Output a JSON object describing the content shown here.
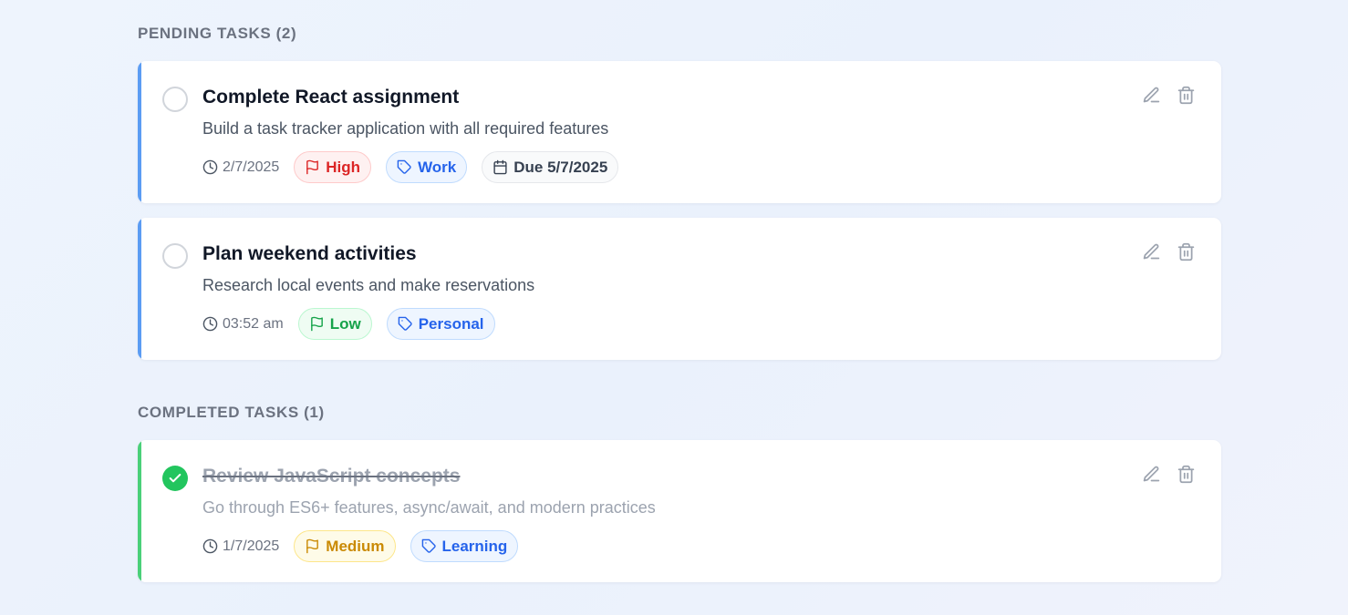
{
  "sections": {
    "pending_title": "PENDING TASKS (2)",
    "completed_title": "COMPLETED TASKS (1)"
  },
  "tasks": [
    {
      "title": "Complete React assignment",
      "description": "Build a task tracker application with all required features",
      "time": "2/7/2025",
      "priority": "High",
      "category": "Work",
      "due": "Due 5/7/2025",
      "completed": false
    },
    {
      "title": "Plan weekend activities",
      "description": "Research local events and make reservations",
      "time": "03:52 am",
      "priority": "Low",
      "category": "Personal",
      "completed": false
    },
    {
      "title": "Review JavaScript concepts",
      "description": "Go through ES6+ features, async/await, and modern practices",
      "time": "1/7/2025",
      "priority": "Medium",
      "category": "Learning",
      "completed": true
    }
  ],
  "colors": {
    "pending_accent": "#5b9cf3",
    "completed_accent": "#4ad079",
    "high": "#dc2626",
    "low": "#16a34a",
    "medium": "#ca8a04",
    "tag": "#2563eb"
  },
  "icons": [
    "clock-icon",
    "flag-icon",
    "tag-icon",
    "calendar-icon",
    "edit-icon",
    "trash-icon",
    "check-icon"
  ]
}
